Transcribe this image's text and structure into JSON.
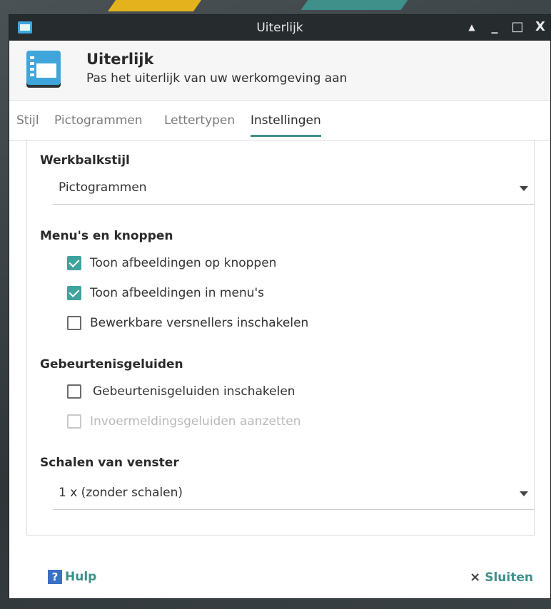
{
  "window": {
    "title": "Uiterlijk",
    "controls": {
      "shade": "▲",
      "minimize": "_",
      "maximize": "□",
      "close": "X"
    }
  },
  "header": {
    "title": "Uiterlijk",
    "subtitle": "Pas het uiterlijk van uw werkomgeving aan",
    "icon": "appearance-icon"
  },
  "tabs": [
    {
      "label": "Stijl",
      "active": false
    },
    {
      "label": "Pictogrammen",
      "active": false
    },
    {
      "label": "Lettertypen",
      "active": false
    },
    {
      "label": "Instellingen",
      "active": true
    }
  ],
  "toolbar_style": {
    "heading": "Werkbalkstijl",
    "selected": "Pictogrammen"
  },
  "menus_buttons": {
    "heading": "Menu's en knoppen",
    "options": [
      {
        "label": "Toon afbeeldingen op knoppen",
        "checked": true,
        "disabled": false
      },
      {
        "label": "Toon afbeeldingen in menu's",
        "checked": true,
        "disabled": false
      },
      {
        "label": "Bewerkbare versnellers inschakelen",
        "checked": false,
        "disabled": false
      }
    ]
  },
  "event_sounds": {
    "heading": "Gebeurtenisgeluiden",
    "options": [
      {
        "label": "Gebeurtenisgeluiden inschakelen",
        "checked": false,
        "disabled": false
      },
      {
        "label": "Invoermeldingsgeluiden aanzetten",
        "checked": false,
        "disabled": true
      }
    ]
  },
  "window_scaling": {
    "heading": "Schalen van venster",
    "selected": "1 x (zonder schalen)"
  },
  "footer": {
    "help_label": "Hulp",
    "help_icon_glyph": "?",
    "close_label": "Sluiten",
    "close_icon_glyph": "×"
  },
  "colors": {
    "accent": "#3e8f8b",
    "checkbox_checked": "#3ea39c",
    "titlebar": "#262b2e",
    "app_icon": "#3fa6dc"
  }
}
